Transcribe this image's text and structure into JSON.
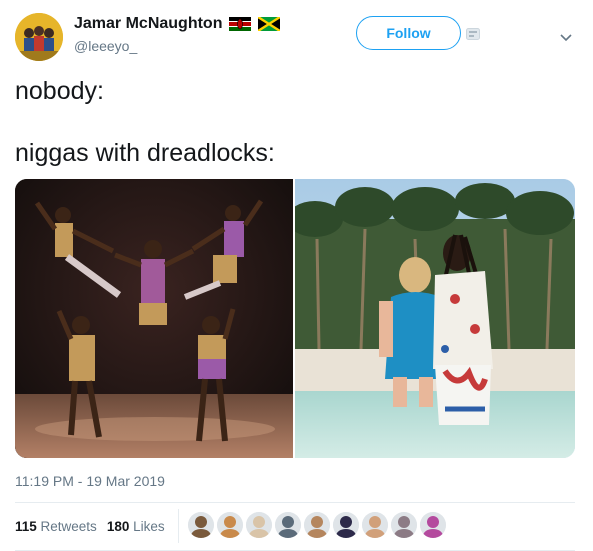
{
  "author": {
    "display_name": "Jamar McNaughton",
    "handle": "@leeeyo_",
    "flags": [
      "kenya-flag",
      "jamaica-flag"
    ]
  },
  "follow_label": "Follow",
  "tweet": {
    "line1": "nobody:",
    "line2": "niggas with dreadlocks:"
  },
  "media": [
    {
      "name": "acrobats-photo"
    },
    {
      "name": "beach-couple-photo"
    }
  ],
  "timestamp": "11:19 PM - 19 Mar 2019",
  "stats": {
    "retweets_count": "115",
    "retweets_label": " Retweets",
    "likes_count": "180",
    "likes_label": " Likes"
  },
  "likers": [
    {
      "color": "#7a5a3c"
    },
    {
      "color": "#c98a4b"
    },
    {
      "color": "#d9c4a8"
    },
    {
      "color": "#5b6b7a"
    },
    {
      "color": "#b5865e"
    },
    {
      "color": "#2d2a4a"
    },
    {
      "color": "#d1a07a"
    },
    {
      "color": "#8c7b85"
    },
    {
      "color": "#b44a9e"
    }
  ]
}
